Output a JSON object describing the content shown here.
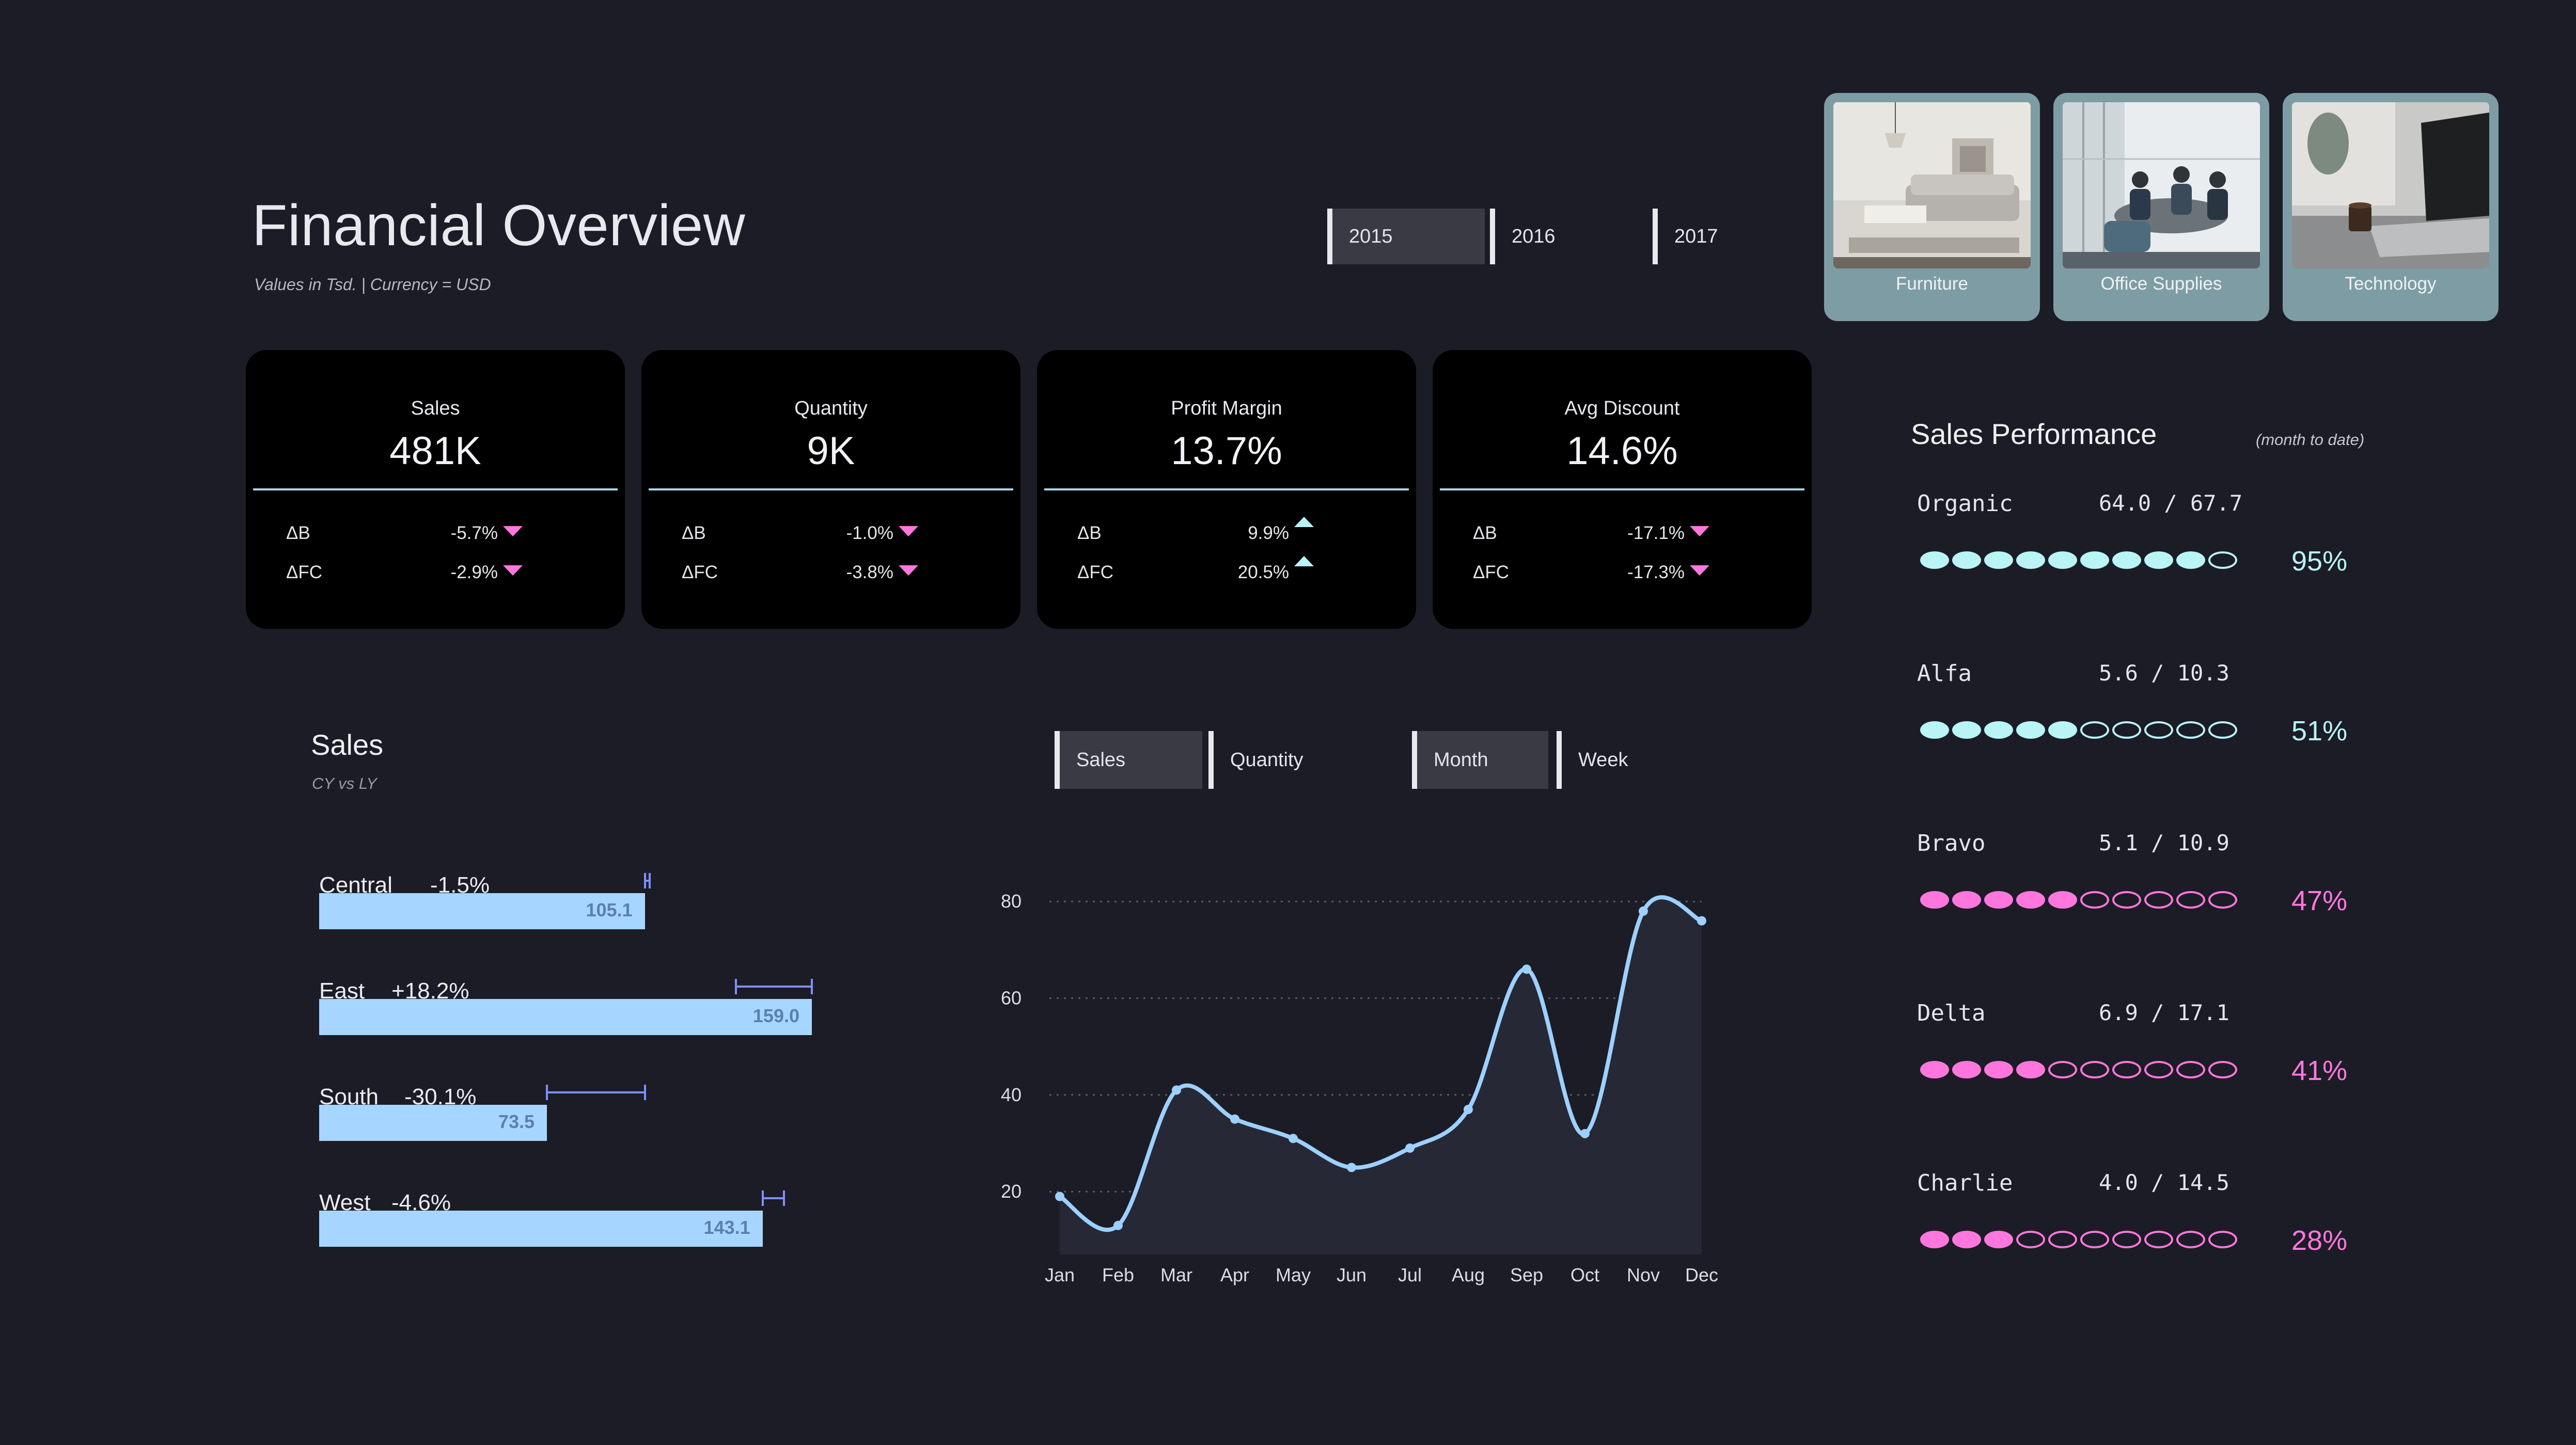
{
  "header": {
    "title": "Financial Overview",
    "subtitle": "Values in Tsd.  |  Currency = USD"
  },
  "years": [
    {
      "label": "2015",
      "active": true
    },
    {
      "label": "2016",
      "active": false
    },
    {
      "label": "2017",
      "active": false
    }
  ],
  "categories": [
    {
      "label": "Furniture",
      "icon": "sofa-photo"
    },
    {
      "label": "Office Supplies",
      "icon": "meeting-photo"
    },
    {
      "label": "Technology",
      "icon": "laptop-photo"
    }
  ],
  "kpis": [
    {
      "title": "Sales",
      "value": "481K",
      "b_label": "ΔB",
      "b_value": "-5.7%",
      "b_dir": "down",
      "fc_label": "ΔFC",
      "fc_value": "-2.9%",
      "fc_dir": "down"
    },
    {
      "title": "Quantity",
      "value": "9K",
      "b_label": "ΔB",
      "b_value": "-1.0%",
      "b_dir": "down",
      "fc_label": "ΔFC",
      "fc_value": "-3.8%",
      "fc_dir": "down"
    },
    {
      "title": "Profit Margin",
      "value": "13.7%",
      "b_label": "ΔB",
      "b_value": "9.9%",
      "b_dir": "up",
      "fc_label": "ΔFC",
      "fc_value": "20.5%",
      "fc_dir": "up"
    },
    {
      "title": "Avg Discount",
      "value": "14.6%",
      "b_label": "ΔB",
      "b_value": "-17.1%",
      "b_dir": "down",
      "fc_label": "ΔFC",
      "fc_value": "-17.3%",
      "fc_dir": "down"
    }
  ],
  "colors": {
    "bg": "#1c1c26",
    "bar": "#a6d6ff",
    "variance": "#7f90ff",
    "up": "#b9f4f6",
    "down": "#ff77dd",
    "line": "#9dd0ff"
  },
  "sales_region": {
    "title": "Sales",
    "subtitle": "CY vs LY",
    "regions": [
      {
        "name": "Central",
        "change": "-1.5%",
        "value": 105.1,
        "value_label": "105.1",
        "ly": 106.7
      },
      {
        "name": "East",
        "change": "+18.2%",
        "value": 159.0,
        "value_label": "159.0",
        "ly": 134.5
      },
      {
        "name": "South",
        "change": "-30.1%",
        "value": 73.5,
        "value_label": "73.5",
        "ly": 105.2
      },
      {
        "name": "West",
        "change": "-4.6%",
        "value": 143.1,
        "value_label": "143.1",
        "ly": 150.0
      }
    ]
  },
  "toggles": {
    "measure": [
      {
        "label": "Sales",
        "active": true
      },
      {
        "label": "Quantity",
        "active": false
      }
    ],
    "period": [
      {
        "label": "Month",
        "active": true
      },
      {
        "label": "Week",
        "active": false
      }
    ]
  },
  "chart_data": {
    "type": "area",
    "categories": [
      "Jan",
      "Feb",
      "Mar",
      "Apr",
      "May",
      "Jun",
      "Jul",
      "Aug",
      "Sep",
      "Oct",
      "Nov",
      "Dec"
    ],
    "values": [
      19,
      13,
      41,
      35,
      31,
      25,
      29,
      37,
      66,
      32,
      78,
      76
    ],
    "yticks": [
      20,
      40,
      60,
      80
    ],
    "ylim": [
      7,
      86
    ],
    "grid": true,
    "title": "",
    "xlabel": "",
    "ylabel": ""
  },
  "performance": {
    "title": "Sales Performance",
    "subtitle": "(month to date)",
    "items": [
      {
        "name": "Organic",
        "value": "64.0 / 67.7",
        "filled": 9,
        "pct": "95%",
        "status": "up"
      },
      {
        "name": "Alfa",
        "value": "5.6 / 10.3",
        "filled": 5,
        "pct": "51%",
        "status": "up"
      },
      {
        "name": "Bravo",
        "value": "5.1 / 10.9",
        "filled": 5,
        "pct": "47%",
        "status": "down"
      },
      {
        "name": "Delta",
        "value": "6.9 / 17.1",
        "filled": 4,
        "pct": "41%",
        "status": "down"
      },
      {
        "name": "Charlie",
        "value": "4.0 / 14.5",
        "filled": 3,
        "pct": "28%",
        "status": "down"
      }
    ]
  }
}
